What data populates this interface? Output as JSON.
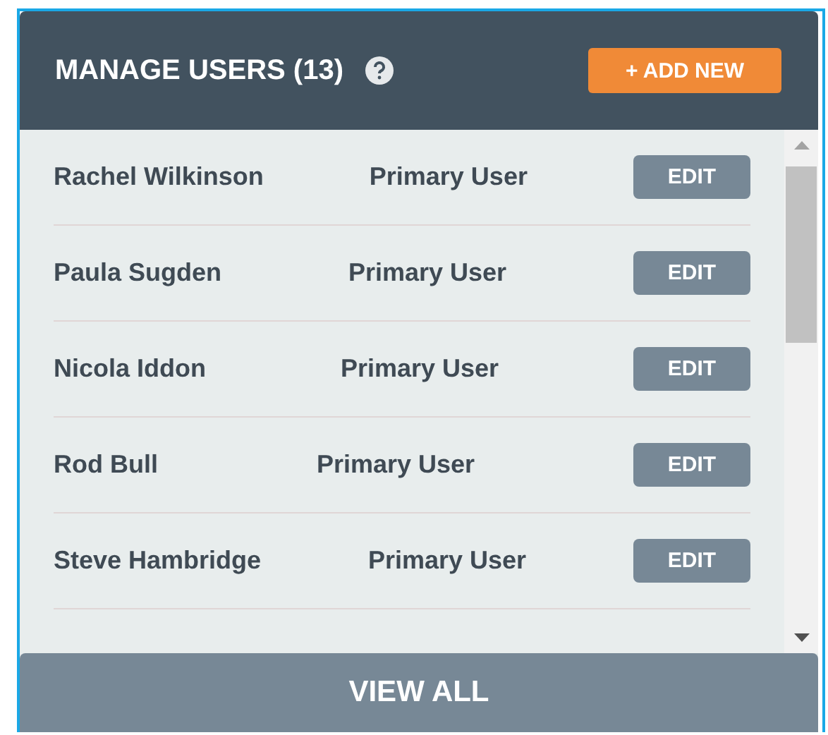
{
  "panel": {
    "title": "MANAGE USERS (13)",
    "add_button": "+ ADD NEW"
  },
  "users": [
    {
      "name": "Rachel Wilkinson",
      "role": "Primary User",
      "action": "EDIT"
    },
    {
      "name": "Paula Sugden",
      "role": "Primary User",
      "action": "EDIT"
    },
    {
      "name": "Nicola Iddon",
      "role": "Primary User",
      "action": "EDIT"
    },
    {
      "name": "Rod Bull",
      "role": "Primary User",
      "action": "EDIT"
    },
    {
      "name": "Steve Hambridge",
      "role": "Primary User",
      "action": "EDIT"
    }
  ],
  "footer_button": "VIEW ALL"
}
